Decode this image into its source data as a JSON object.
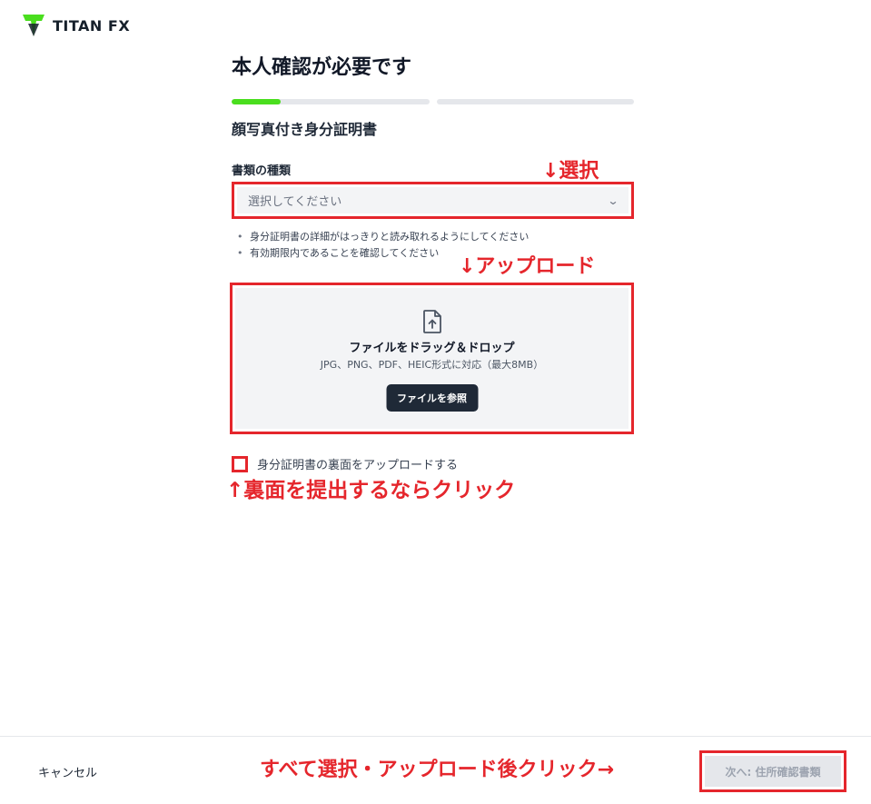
{
  "brand": {
    "logo_text": "TITAN FX",
    "accent": "#4ade1e"
  },
  "page": {
    "title": "本人確認が必要です",
    "subtitle": "顔写真付き身分証明書"
  },
  "progress": {
    "steps": 2,
    "current_step": 1,
    "fill_fraction": 0.25
  },
  "document_type": {
    "label": "書類の種類",
    "placeholder": "選択してください"
  },
  "notes": [
    "身分証明書の詳細がはっきりと読み取れるようにしてください",
    "有効期限内であることを確認してください"
  ],
  "upload": {
    "icon": "file-upload-icon",
    "title": "ファイルをドラッグ＆ドロップ",
    "formats": "JPG、PNG、PDF、HEIC形式に対応（最大8MB）",
    "browse_label": "ファイルを参照"
  },
  "back_side": {
    "label": "身分証明書の裏面をアップロードする",
    "checked": false
  },
  "annotations": {
    "select": "↓選択",
    "upload": "↓アップロード",
    "back": "↑裏面を提出するならクリック",
    "next": "すべて選択・アップロード後クリック→",
    "color": "#e5262c"
  },
  "footer": {
    "cancel_label": "キャンセル",
    "next_label": "次へ: 住所確認書類"
  }
}
